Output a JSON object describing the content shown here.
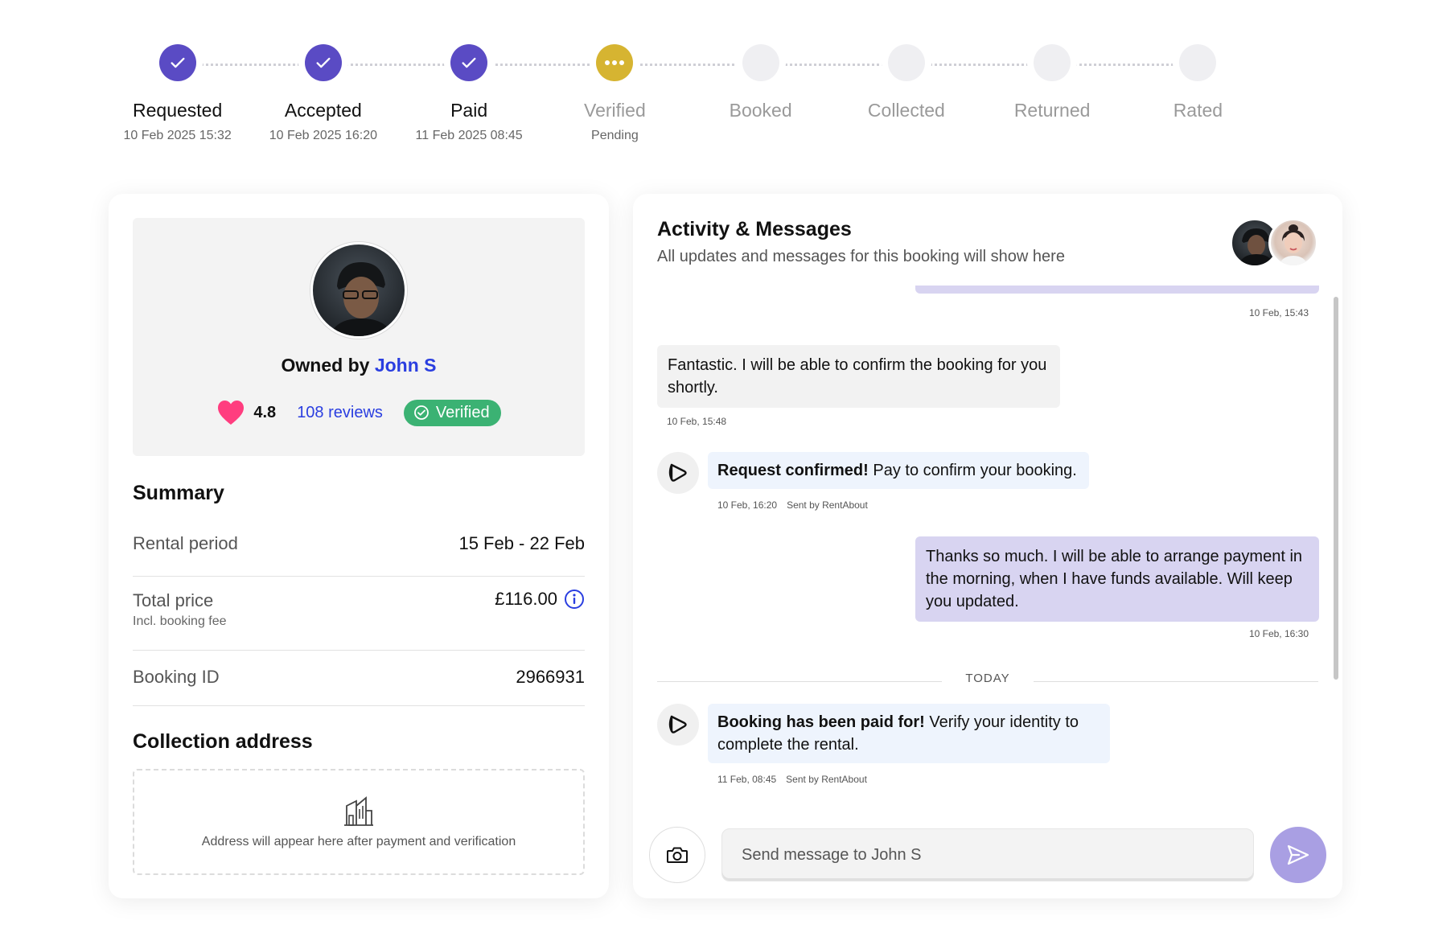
{
  "colors": {
    "step_done": "#5a4bc4",
    "step_current": "#d6b431",
    "step_todo": "#efeff2",
    "link": "#2a3ee0",
    "verified_green": "#3bb273",
    "heart_pink": "#ff3d7f",
    "outgoing_bubble": "#d8d4f1",
    "system_bubble": "#eef4fd",
    "send_button": "#a99fe3"
  },
  "stepper": {
    "steps": [
      {
        "label": "Requested",
        "sub": "10 Feb 2025 15:32",
        "status": "done",
        "icon": "check-icon"
      },
      {
        "label": "Accepted",
        "sub": "10 Feb 2025 16:20",
        "status": "done",
        "icon": "check-icon"
      },
      {
        "label": "Paid",
        "sub": "11 Feb 2025 08:45",
        "status": "done",
        "icon": "check-icon"
      },
      {
        "label": "Verified",
        "sub": "Pending",
        "status": "current",
        "icon": "ellipsis-icon"
      },
      {
        "label": "Booked",
        "sub": "",
        "status": "todo",
        "icon": ""
      },
      {
        "label": "Collected",
        "sub": "",
        "status": "todo",
        "icon": ""
      },
      {
        "label": "Returned",
        "sub": "",
        "status": "todo",
        "icon": ""
      },
      {
        "label": "Rated",
        "sub": "",
        "status": "todo",
        "icon": ""
      }
    ]
  },
  "owner": {
    "prefix": "Owned by",
    "name": "John S",
    "rating": "4.8",
    "reviews": "108 reviews",
    "verified": "Verified"
  },
  "summary": {
    "title": "Summary",
    "rental_period_label": "Rental period",
    "rental_period_value": "15 Feb - 22 Feb",
    "total_price_label": "Total price",
    "total_price_sub": "Incl. booking fee",
    "total_price_value": "£116.00",
    "booking_id_label": "Booking ID",
    "booking_id_value": "2966931"
  },
  "collection": {
    "title": "Collection address",
    "note": "Address will appear here after payment and verification"
  },
  "activity": {
    "title": "Activity & Messages",
    "subtitle": "All updates and messages for this booking will show here",
    "messages": {
      "m0_time": "10 Feb, 15:43",
      "m1_text": "Fantastic. I will be able to confirm the booking for you shortly.",
      "m1_time": "10 Feb, 15:48",
      "m2_bold": "Request confirmed!",
      "m2_text": " Pay to confirm your booking.",
      "m2_time": "10 Feb, 16:20",
      "m2_by": "Sent by RentAbout",
      "m3_text": "Thanks so much. I will be able to arrange payment in the morning, when I have funds available. Will keep you updated.",
      "m3_time": "10 Feb, 16:30",
      "separator": "TODAY",
      "m4_bold": "Booking has been paid for!",
      "m4_text": " Verify your identity to complete the rental.",
      "m4_time": "11 Feb, 08:45",
      "m4_by": "Sent by RentAbout"
    },
    "composer_placeholder": "Send message to John S"
  }
}
